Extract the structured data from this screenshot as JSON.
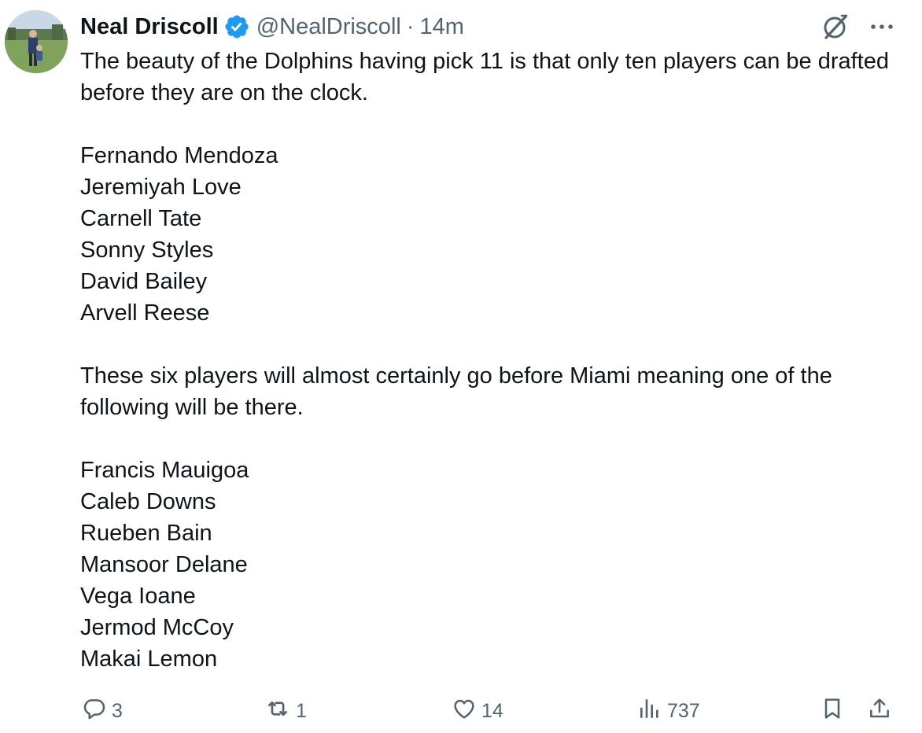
{
  "author": {
    "name": "Neal Driscoll",
    "handle": "@NealDriscoll",
    "separator": "·",
    "time": "14m"
  },
  "icons": {
    "verified": "verified-badge-icon",
    "grok": "grok-icon",
    "more": "more-icon",
    "reply": "reply-icon",
    "retweet": "retweet-icon",
    "like": "like-icon",
    "views": "views-icon",
    "bookmark": "bookmark-icon",
    "share": "share-icon"
  },
  "tweet": {
    "intro": "The beauty of the Dolphins having pick 11 is that only ten players can be drafted before they are on the clock.",
    "group1": [
      "Fernando Mendoza",
      "Jeremiyah Love",
      "Carnell Tate",
      "Sonny Styles",
      "David Bailey",
      "Arvell Reese"
    ],
    "middle": "These six players will almost certainly go before Miami meaning one of the following will be there.",
    "group2": [
      "Francis Mauigoa",
      "Caleb Downs",
      "Rueben Bain",
      "Mansoor Delane",
      "Vega Ioane",
      "Jermod McCoy",
      "Makai Lemon"
    ]
  },
  "stats": {
    "replies": "3",
    "retweets": "1",
    "likes": "14",
    "views": "737"
  },
  "colors": {
    "text": "#0f1419",
    "secondary": "#536471",
    "verified": "#1d9bf0"
  }
}
